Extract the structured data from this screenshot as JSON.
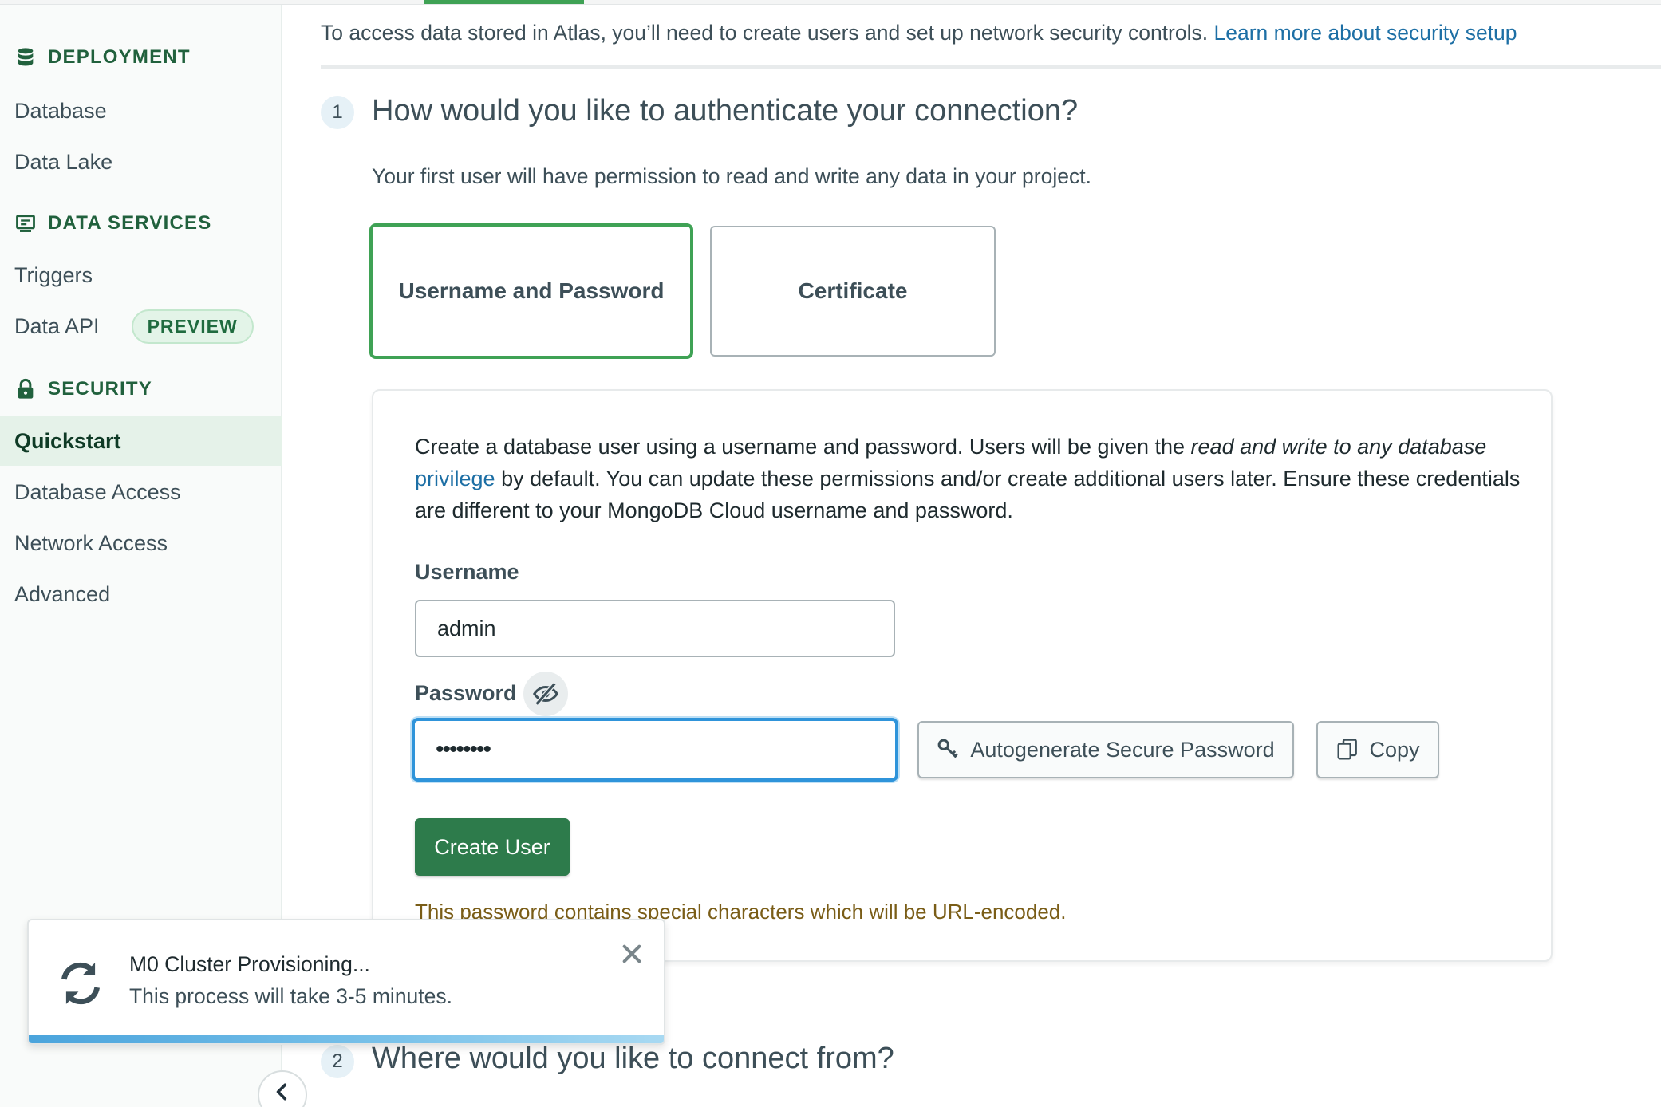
{
  "sidebar": {
    "sections": [
      {
        "title": "DEPLOYMENT",
        "icon": "database-icon",
        "items": [
          "Database",
          "Data Lake"
        ]
      },
      {
        "title": "DATA SERVICES",
        "icon": "monitor-icon",
        "items": [
          "Triggers",
          "Data API"
        ]
      },
      {
        "title": "SECURITY",
        "icon": "lock-icon",
        "items": [
          "Quickstart",
          "Database Access",
          "Network Access",
          "Advanced"
        ]
      }
    ],
    "data_api_badge": "PREVIEW",
    "active_item": "Quickstart"
  },
  "intro": {
    "text": "To access data stored in Atlas, you’ll need to create users and set up network security controls. ",
    "link": "Learn more about security setup"
  },
  "step1": {
    "number": "1",
    "title": "How would you like to authenticate your connection?",
    "subtitle": "Your first user will have permission to read and write any data in your project.",
    "options": [
      {
        "label": "Username and Password",
        "selected": true
      },
      {
        "label": "Certificate",
        "selected": false
      }
    ]
  },
  "card": {
    "desc_part1": "Create a database user using a username and password. Users will be given the ",
    "desc_italic": "read and write to any database",
    "desc_link": "privilege",
    "desc_part2": " by default. You can update these permissions and/or create additional users later. Ensure these credentials are different to your MongoDB Cloud username and password.",
    "username_label": "Username",
    "username_value": "admin",
    "password_label": "Password",
    "password_value": "••••••••",
    "autogenerate_label": "Autogenerate Secure Password",
    "copy_label": "Copy",
    "create_user_label": "Create User",
    "warning": "This password contains special characters which will be URL-encoded."
  },
  "step2": {
    "number": "2",
    "title": "Where would you like to connect from?"
  },
  "toast": {
    "title": "M0 Cluster Provisioning...",
    "body": "This process will take 3-5 minutes."
  },
  "colors": {
    "brand_green": "#3fa255",
    "primary_button": "#2d7b4b",
    "link": "#1d6fa5",
    "focus_blue": "#2f94da",
    "warning_text": "#7a5d17"
  }
}
